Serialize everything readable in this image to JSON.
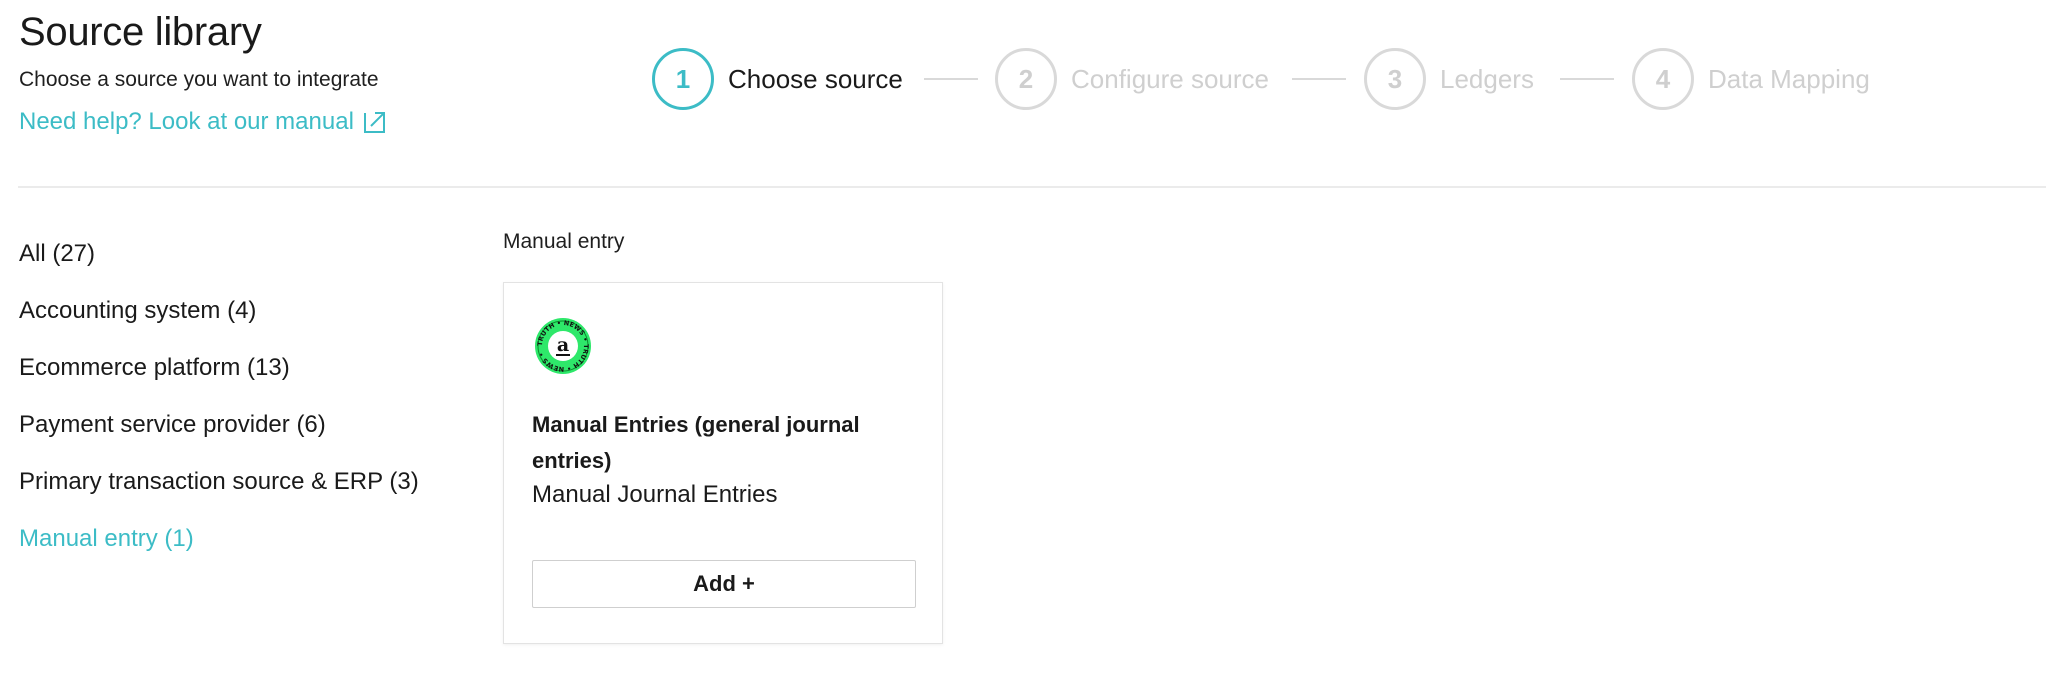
{
  "header": {
    "title": "Source library",
    "subtitle": "Choose a source you want to integrate",
    "help_link": "Need help? Look at our manual",
    "help_icon": "external-link-icon"
  },
  "stepper": {
    "active_step": 1,
    "steps": [
      {
        "number": "1",
        "label": "Choose source"
      },
      {
        "number": "2",
        "label": "Configure source"
      },
      {
        "number": "3",
        "label": "Ledgers"
      },
      {
        "number": "4",
        "label": "Data Mapping"
      }
    ]
  },
  "sidebar": {
    "categories": [
      {
        "label": "All (27)"
      },
      {
        "label": "Accounting system (4)"
      },
      {
        "label": "Ecommerce platform (13)"
      },
      {
        "label": "Payment service provider (6)"
      },
      {
        "label": "Primary transaction source & ERP (3)"
      },
      {
        "label": "Manual entry (1)"
      }
    ],
    "active_index": 5
  },
  "main": {
    "section_title": "Manual entry",
    "cards": [
      {
        "logo_icon": "amazon-logo-icon",
        "logo_letter": "a",
        "logo_ring_text": "TRUTH • NEWS • TRUTH • NEWS •",
        "title": "Manual Entries (general journal entries)",
        "subtitle": "Manual Journal Entries",
        "button_label": "Add +"
      }
    ]
  },
  "colors": {
    "accent": "#3cbcc6",
    "inactive": "#cfcfcf",
    "logo_green": "#2ee86a"
  }
}
